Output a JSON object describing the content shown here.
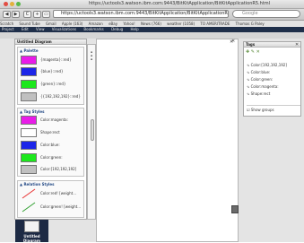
{
  "window": {
    "title": "https://uctools3.watson.ibm.com:9443/BitKitApplication/BitKitApplicationR5.html"
  },
  "toolbar": {
    "url": "https://uctools3.watson.ibm.com:9443/BitKitApplication/BitKitApplicationR5.html",
    "search_placeholder": "Google",
    "back_glyph": "◀",
    "forward_glyph": "▶",
    "reload_glyph": "C",
    "add_glyph": "+"
  },
  "bookmarks": [
    "Scratch",
    "Sound Tube",
    "Gmail",
    "Apple (163)",
    "Amazon",
    "eBay",
    "Yahoo!",
    "News (766)",
    "weather (1058)",
    "TO AMERITRADE",
    "Thomas G Paley"
  ],
  "menubar": [
    "Project",
    "Edit",
    "View",
    "Visualizations",
    "Bookmarks",
    "Debug",
    "Help"
  ],
  "palette": {
    "title": "Untitled Diagram",
    "sections": {
      "palette": {
        "title": "Palette",
        "items": [
          {
            "label": "{magenta}::red}",
            "color": "#e81ce8"
          },
          {
            "label": "{blue}::red}",
            "color": "#1c25e8"
          },
          {
            "label": "{green}::red}",
            "color": "#1ce81c"
          },
          {
            "label": "{{192,192,192}::red}",
            "color": "#c0c0c0"
          }
        ]
      },
      "tag_styles": {
        "title": "Tag Styles",
        "items": [
          {
            "label": "Color:magenta:",
            "color": "#e81ce8"
          },
          {
            "label": "Shape:rect",
            "color": "#ffffff"
          },
          {
            "label": "Color:blue:",
            "color": "#1c25e8"
          },
          {
            "label": "Color:green:",
            "color": "#1ce81c"
          },
          {
            "label": "Color:[192,192,192]",
            "color": "#c0c0c0"
          }
        ]
      },
      "relation_styles": {
        "title": "Relation Styles",
        "items": [
          {
            "label": "Color:red! [weight...",
            "color": "#e83030"
          },
          {
            "label": "Color:green! [weight...",
            "color": "#30a030"
          }
        ]
      }
    }
  },
  "tags_panel": {
    "title": "Tags",
    "items": [
      "Color:[192,192,192]",
      "Color:blue:",
      "Color:green:",
      "Color:magenta:",
      "Shape:rect"
    ],
    "show_groups_label": "Show groups"
  },
  "thumbnail": {
    "label": "Untitled Diagram"
  }
}
